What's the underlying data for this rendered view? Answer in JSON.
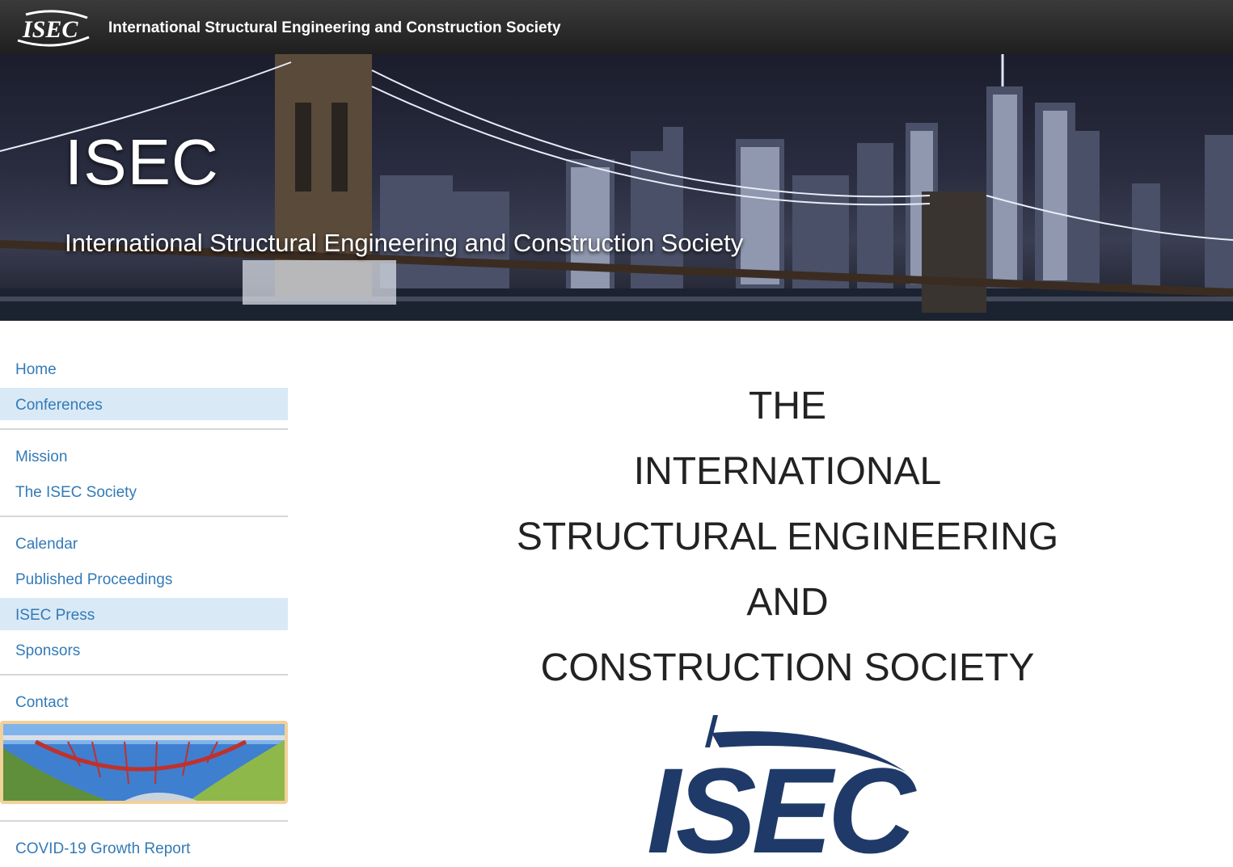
{
  "navbar": {
    "logo_text": "ISEC",
    "title": "International Structural Engineering and Construction Society"
  },
  "banner": {
    "title": "ISEC",
    "subtitle": "International Structural Engineering and Construction Society"
  },
  "sidebar": {
    "groups": [
      [
        {
          "label": "Home",
          "active": false
        },
        {
          "label": "Conferences",
          "active": true
        }
      ],
      [
        {
          "label": "Mission",
          "active": false
        },
        {
          "label": "The ISEC Society",
          "active": false
        }
      ],
      [
        {
          "label": "Calendar",
          "active": false
        },
        {
          "label": "Published Proceedings",
          "active": false
        },
        {
          "label": "ISEC Press",
          "active": true
        },
        {
          "label": "Sponsors",
          "active": false
        }
      ],
      [
        {
          "label": "Contact",
          "active": false
        }
      ],
      [
        {
          "label": "COVID-19 Growth Report",
          "active": false
        }
      ]
    ]
  },
  "main": {
    "heading_lines": [
      "THE",
      "INTERNATIONAL",
      "STRUCTURAL ENGINEERING",
      "AND",
      "CONSTRUCTION SOCIETY"
    ],
    "logo_text": "ISEC"
  },
  "colors": {
    "link": "#337ab7",
    "active_bg": "#d9e9f6",
    "logo_navy": "#1f3a68",
    "promo_border": "#f2d19a"
  }
}
